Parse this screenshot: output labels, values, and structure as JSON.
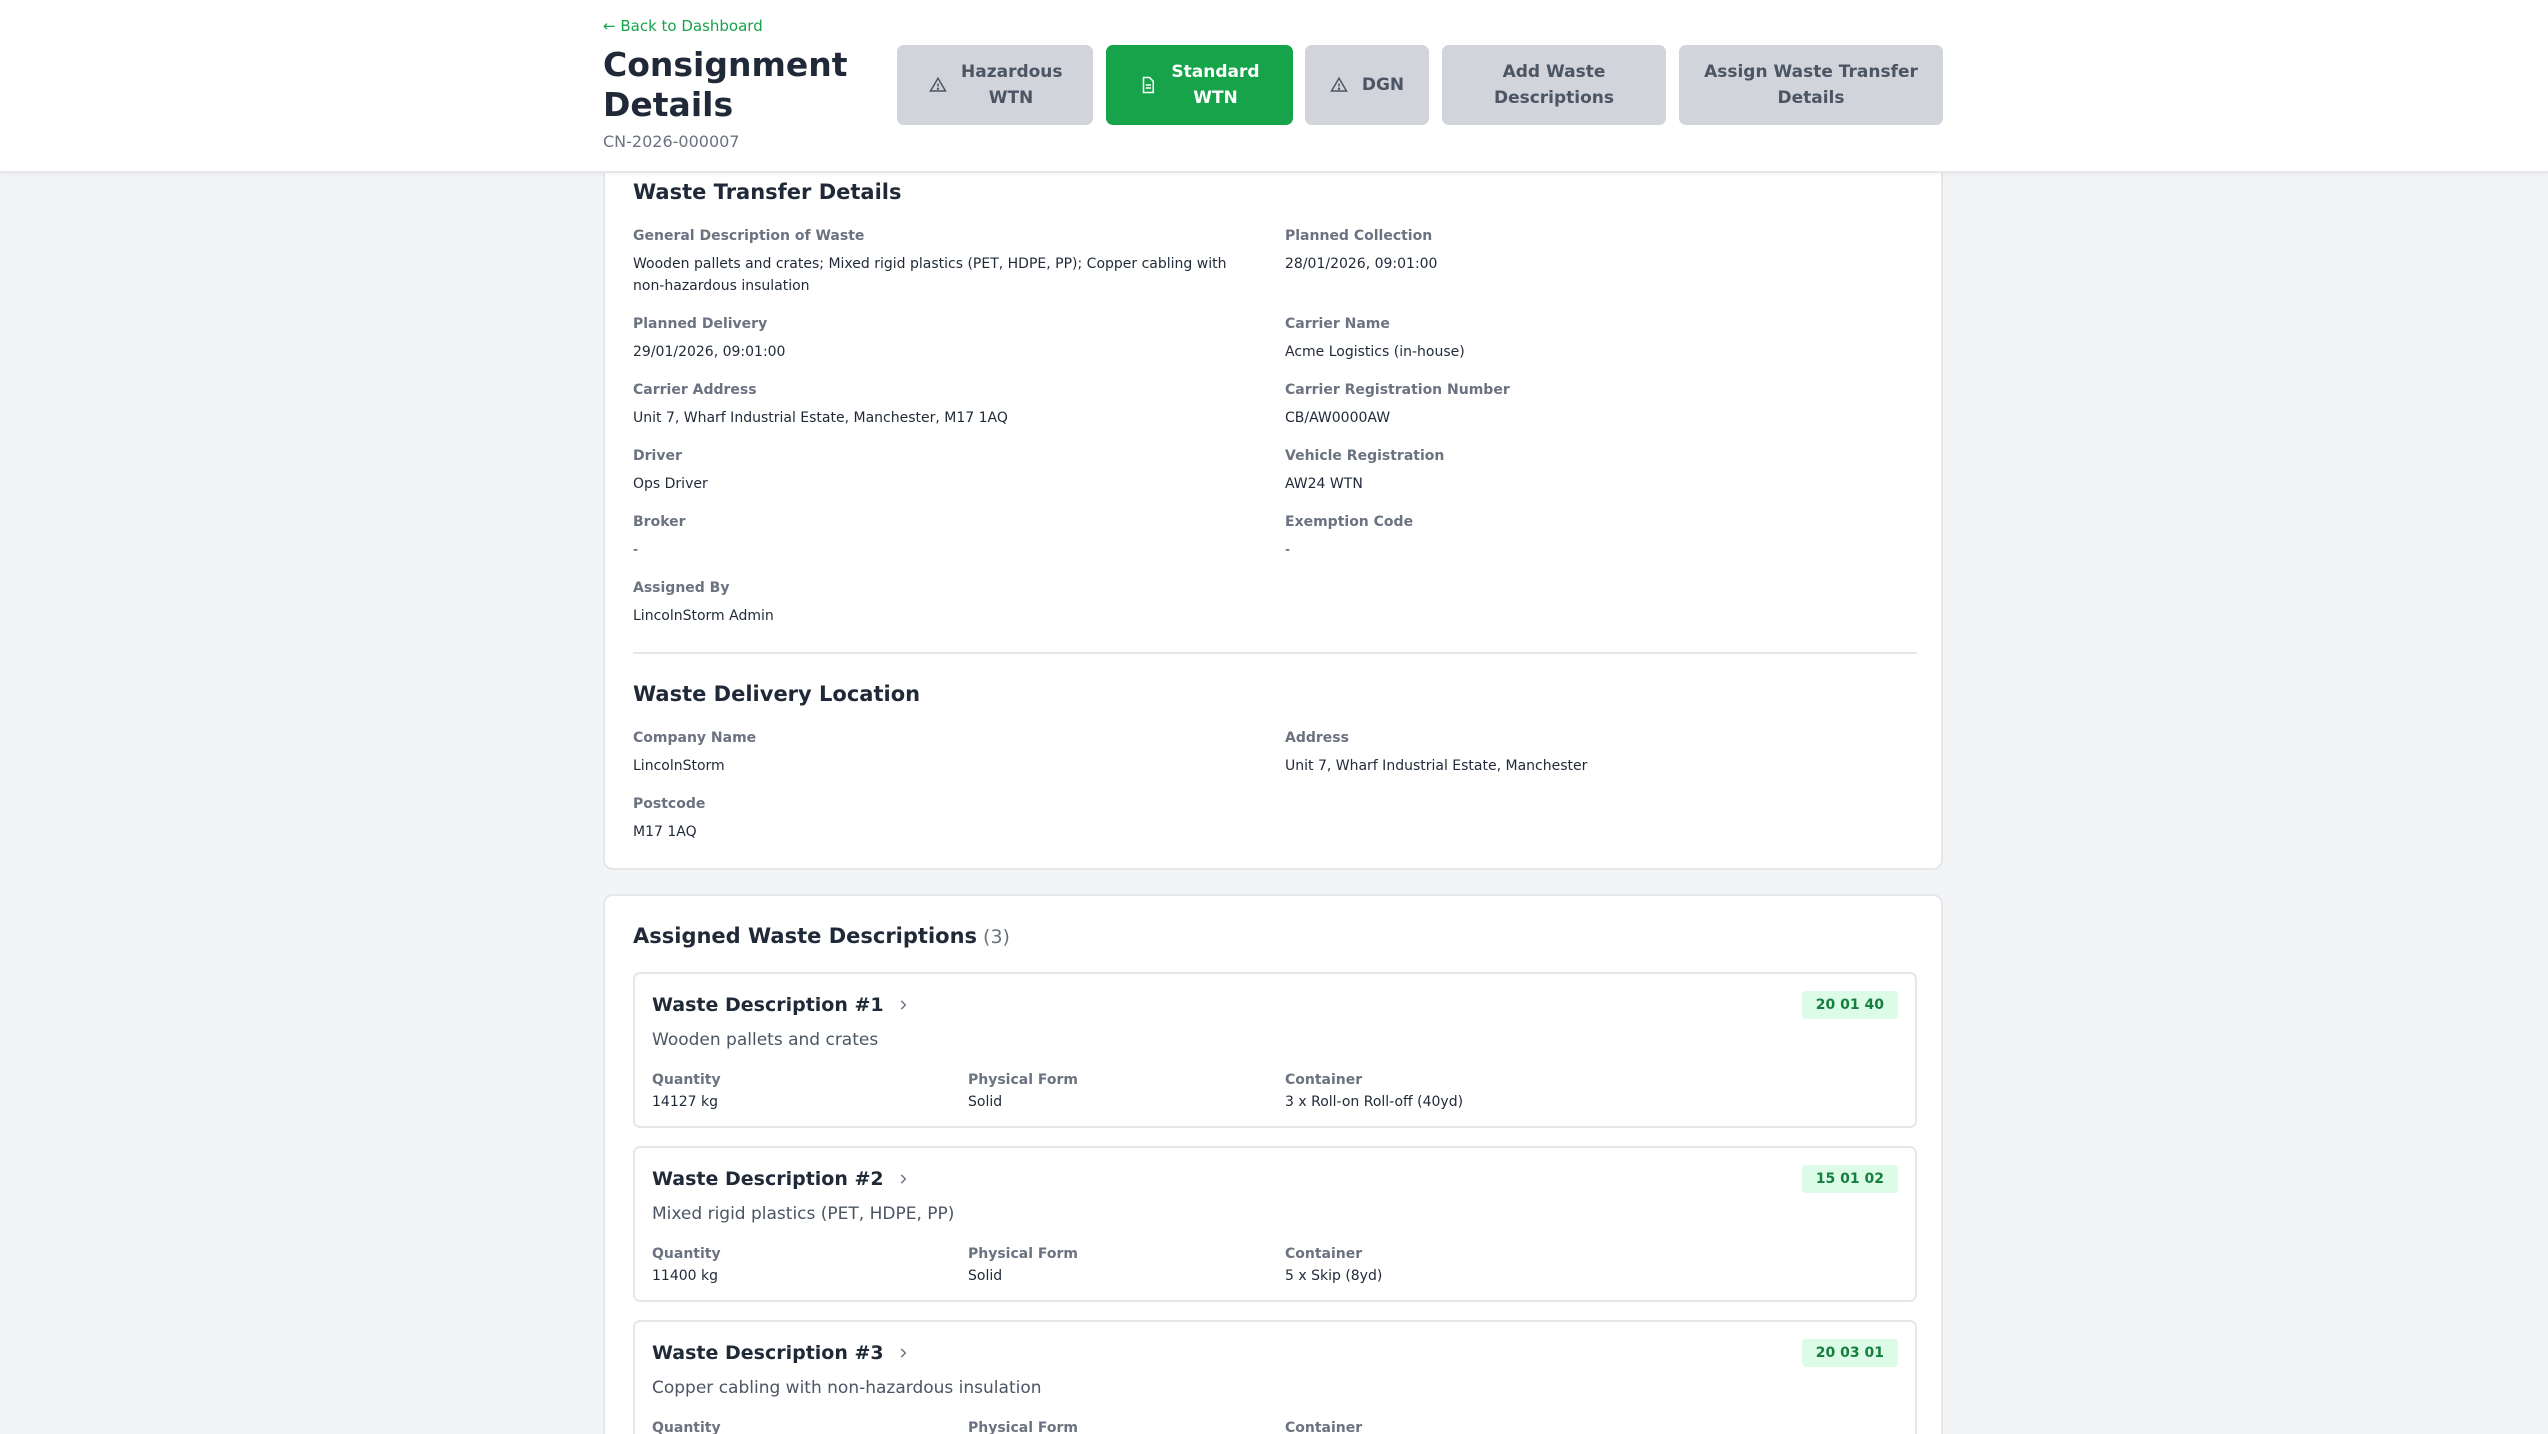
{
  "header": {
    "back_link": "← Back to Dashboard",
    "title": "Consignment Details",
    "consignment_id": "CN-2026-000007",
    "buttons": {
      "hazardous": "Hazardous WTN",
      "standard": "Standard WTN",
      "dgn": "DGN",
      "add_waste": "Add Waste Descriptions",
      "assign_transfer": "Assign Waste Transfer Details"
    }
  },
  "transfer": {
    "title": "Waste Transfer Details",
    "fields": [
      {
        "label": "General Description of Waste",
        "value": "Wooden pallets and crates; Mixed rigid plastics (PET, HDPE, PP); Copper cabling with non-hazardous insulation"
      },
      {
        "label": "Planned Collection",
        "value": "28/01/2026, 09:01:00"
      },
      {
        "label": "Planned Delivery",
        "value": "29/01/2026, 09:01:00"
      },
      {
        "label": "Carrier Name",
        "value": "Acme Logistics (in-house)"
      },
      {
        "label": "Carrier Address",
        "value": "Unit 7, Wharf Industrial Estate, Manchester, M17 1AQ"
      },
      {
        "label": "Carrier Registration Number",
        "value": "CB/AW0000AW"
      },
      {
        "label": "Driver",
        "value": "Ops Driver"
      },
      {
        "label": "Vehicle Registration",
        "value": "AW24 WTN"
      },
      {
        "label": "Broker",
        "value": "-"
      },
      {
        "label": "Exemption Code",
        "value": "-"
      },
      {
        "label": "Assigned By",
        "value": "LincolnStorm Admin"
      }
    ]
  },
  "delivery": {
    "title": "Waste Delivery Location",
    "fields": [
      {
        "label": "Company Name",
        "value": "LincolnStorm"
      },
      {
        "label": "Address",
        "value": "Unit 7, Wharf Industrial Estate, Manchester"
      },
      {
        "label": "Postcode",
        "value": "M17 1AQ"
      }
    ]
  },
  "assigned": {
    "title": "Assigned Waste Descriptions",
    "count": "(3)",
    "labels": {
      "quantity": "Quantity",
      "physical_form": "Physical Form",
      "container": "Container"
    },
    "items": [
      {
        "title": "Waste Description #1",
        "description": "Wooden pallets and crates",
        "ewc": "20 01 40",
        "quantity": "14127 kg",
        "physical_form": "Solid",
        "container": "3 x Roll-on Roll-off (40yd)"
      },
      {
        "title": "Waste Description #2",
        "description": "Mixed rigid plastics (PET, HDPE, PP)",
        "ewc": "15 01 02",
        "quantity": "11400 kg",
        "physical_form": "Solid",
        "container": "5 x Skip (8yd)"
      },
      {
        "title": "Waste Description #3",
        "description": "Copper cabling with non-hazardous insulation",
        "ewc": "20 03 01",
        "quantity": "",
        "physical_form": "",
        "container": ""
      }
    ]
  },
  "colors": {
    "primary": "#16a34a",
    "button_inactive": "#d1d5db",
    "badge_bg": "#dcfce7",
    "badge_text": "#15803d"
  },
  "icons": {
    "hazardous": "warning-triangle-icon",
    "standard": "document-icon",
    "dgn": "warning-triangle-icon",
    "waste_item": "chevron-right-icon"
  }
}
